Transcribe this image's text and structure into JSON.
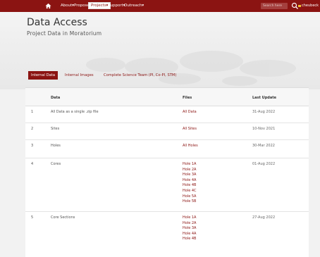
{
  "nav": {
    "items": [
      "About▾",
      "Proposes▾",
      "Projects▾",
      "Support▾",
      "Outreach▾"
    ],
    "active_index": 2,
    "search_placeholder": "Search here",
    "username": "cheubeck"
  },
  "header": {
    "title": "Data Access",
    "subtitle": "Project Data in Moratorium"
  },
  "tabs": [
    "Internal Data",
    "Internal Images",
    "Complete Science Team (PI, Co-PI, STM)"
  ],
  "table": {
    "headers": [
      "Data",
      "Files",
      "Last Update"
    ],
    "rows": [
      {
        "index": "1",
        "data": "All Data as a single .zip file",
        "files": [
          "All Data"
        ],
        "updated": [
          "31-Aug",
          "2022"
        ]
      },
      {
        "index": "2",
        "data": "Sites",
        "files": [
          "All Sites"
        ],
        "updated": [
          "10-Nov",
          "2021"
        ]
      },
      {
        "index": "3",
        "data": "Holes",
        "files": [
          "All Holes"
        ],
        "updated": [
          "30-Mar",
          "2022"
        ]
      },
      {
        "index": "4",
        "data": "Cores",
        "files": [
          "Hole 1A",
          "Hole 2A",
          "Hole 3A",
          "Hole 4A",
          "Hole 4B",
          "Hole 4C",
          "Hole 5A",
          "Hole 5B"
        ],
        "updated": [
          "01-Aug",
          "2022"
        ]
      },
      {
        "index": "5",
        "data": "Core Sections",
        "files": [
          "Hole 1A",
          "Hole 2A",
          "Hole 3A",
          "Hole 4A",
          "Hole 4B"
        ],
        "updated": [
          "27-Aug",
          "2022"
        ]
      }
    ]
  },
  "colors": {
    "brand": "#8b1412",
    "user_accent": "#f2c230"
  }
}
